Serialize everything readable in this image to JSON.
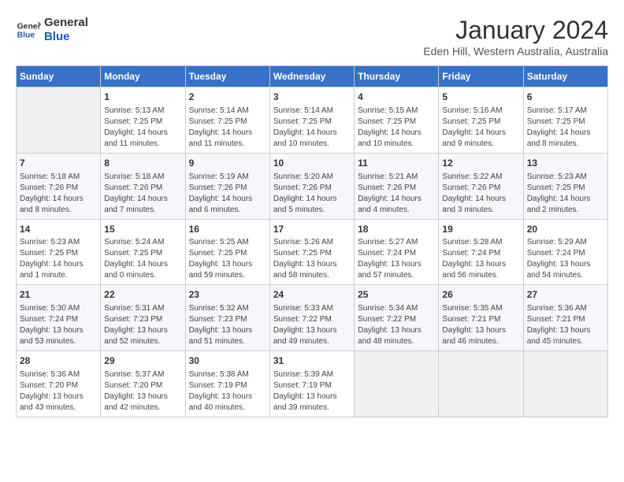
{
  "logo": {
    "line1": "General",
    "line2": "Blue"
  },
  "title": "January 2024",
  "subtitle": "Eden Hill, Western Australia, Australia",
  "days_of_week": [
    "Sunday",
    "Monday",
    "Tuesday",
    "Wednesday",
    "Thursday",
    "Friday",
    "Saturday"
  ],
  "weeks": [
    [
      {
        "day": "",
        "info": ""
      },
      {
        "day": "1",
        "info": "Sunrise: 5:13 AM\nSunset: 7:25 PM\nDaylight: 14 hours\nand 11 minutes."
      },
      {
        "day": "2",
        "info": "Sunrise: 5:14 AM\nSunset: 7:25 PM\nDaylight: 14 hours\nand 11 minutes."
      },
      {
        "day": "3",
        "info": "Sunrise: 5:14 AM\nSunset: 7:25 PM\nDaylight: 14 hours\nand 10 minutes."
      },
      {
        "day": "4",
        "info": "Sunrise: 5:15 AM\nSunset: 7:25 PM\nDaylight: 14 hours\nand 10 minutes."
      },
      {
        "day": "5",
        "info": "Sunrise: 5:16 AM\nSunset: 7:25 PM\nDaylight: 14 hours\nand 9 minutes."
      },
      {
        "day": "6",
        "info": "Sunrise: 5:17 AM\nSunset: 7:25 PM\nDaylight: 14 hours\nand 8 minutes."
      }
    ],
    [
      {
        "day": "7",
        "info": "Sunrise: 5:18 AM\nSunset: 7:26 PM\nDaylight: 14 hours\nand 8 minutes."
      },
      {
        "day": "8",
        "info": "Sunrise: 5:18 AM\nSunset: 7:26 PM\nDaylight: 14 hours\nand 7 minutes."
      },
      {
        "day": "9",
        "info": "Sunrise: 5:19 AM\nSunset: 7:26 PM\nDaylight: 14 hours\nand 6 minutes."
      },
      {
        "day": "10",
        "info": "Sunrise: 5:20 AM\nSunset: 7:26 PM\nDaylight: 14 hours\nand 5 minutes."
      },
      {
        "day": "11",
        "info": "Sunrise: 5:21 AM\nSunset: 7:26 PM\nDaylight: 14 hours\nand 4 minutes."
      },
      {
        "day": "12",
        "info": "Sunrise: 5:22 AM\nSunset: 7:26 PM\nDaylight: 14 hours\nand 3 minutes."
      },
      {
        "day": "13",
        "info": "Sunrise: 5:23 AM\nSunset: 7:25 PM\nDaylight: 14 hours\nand 2 minutes."
      }
    ],
    [
      {
        "day": "14",
        "info": "Sunrise: 5:23 AM\nSunset: 7:25 PM\nDaylight: 14 hours\nand 1 minute."
      },
      {
        "day": "15",
        "info": "Sunrise: 5:24 AM\nSunset: 7:25 PM\nDaylight: 14 hours\nand 0 minutes."
      },
      {
        "day": "16",
        "info": "Sunrise: 5:25 AM\nSunset: 7:25 PM\nDaylight: 13 hours\nand 59 minutes."
      },
      {
        "day": "17",
        "info": "Sunrise: 5:26 AM\nSunset: 7:25 PM\nDaylight: 13 hours\nand 58 minutes."
      },
      {
        "day": "18",
        "info": "Sunrise: 5:27 AM\nSunset: 7:24 PM\nDaylight: 13 hours\nand 57 minutes."
      },
      {
        "day": "19",
        "info": "Sunrise: 5:28 AM\nSunset: 7:24 PM\nDaylight: 13 hours\nand 56 minutes."
      },
      {
        "day": "20",
        "info": "Sunrise: 5:29 AM\nSunset: 7:24 PM\nDaylight: 13 hours\nand 54 minutes."
      }
    ],
    [
      {
        "day": "21",
        "info": "Sunrise: 5:30 AM\nSunset: 7:24 PM\nDaylight: 13 hours\nand 53 minutes."
      },
      {
        "day": "22",
        "info": "Sunrise: 5:31 AM\nSunset: 7:23 PM\nDaylight: 13 hours\nand 52 minutes."
      },
      {
        "day": "23",
        "info": "Sunrise: 5:32 AM\nSunset: 7:23 PM\nDaylight: 13 hours\nand 51 minutes."
      },
      {
        "day": "24",
        "info": "Sunrise: 5:33 AM\nSunset: 7:22 PM\nDaylight: 13 hours\nand 49 minutes."
      },
      {
        "day": "25",
        "info": "Sunrise: 5:34 AM\nSunset: 7:22 PM\nDaylight: 13 hours\nand 48 minutes."
      },
      {
        "day": "26",
        "info": "Sunrise: 5:35 AM\nSunset: 7:21 PM\nDaylight: 13 hours\nand 46 minutes."
      },
      {
        "day": "27",
        "info": "Sunrise: 5:36 AM\nSunset: 7:21 PM\nDaylight: 13 hours\nand 45 minutes."
      }
    ],
    [
      {
        "day": "28",
        "info": "Sunrise: 5:36 AM\nSunset: 7:20 PM\nDaylight: 13 hours\nand 43 minutes."
      },
      {
        "day": "29",
        "info": "Sunrise: 5:37 AM\nSunset: 7:20 PM\nDaylight: 13 hours\nand 42 minutes."
      },
      {
        "day": "30",
        "info": "Sunrise: 5:38 AM\nSunset: 7:19 PM\nDaylight: 13 hours\nand 40 minutes."
      },
      {
        "day": "31",
        "info": "Sunrise: 5:39 AM\nSunset: 7:19 PM\nDaylight: 13 hours\nand 39 minutes."
      },
      {
        "day": "",
        "info": ""
      },
      {
        "day": "",
        "info": ""
      },
      {
        "day": "",
        "info": ""
      }
    ]
  ]
}
